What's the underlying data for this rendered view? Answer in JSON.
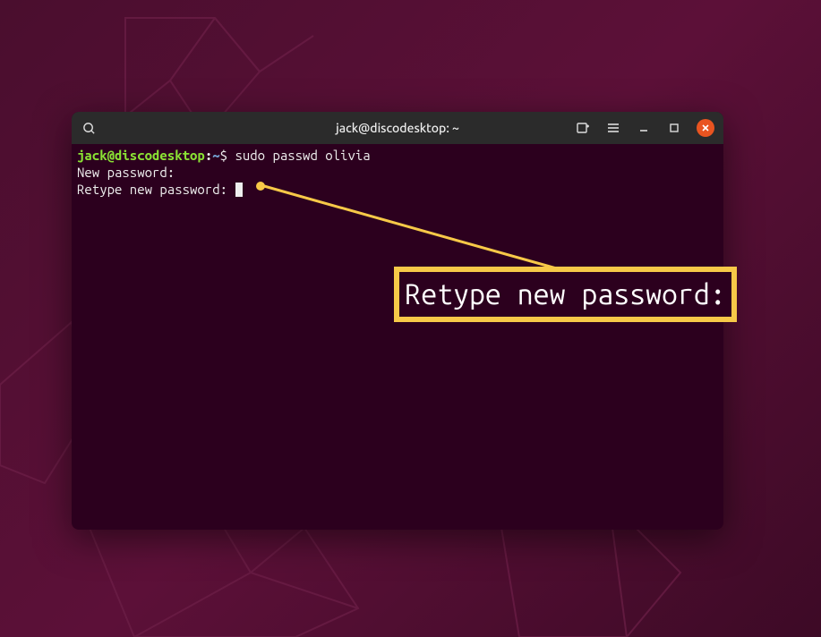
{
  "window": {
    "title": "jack@discodesktop: ~"
  },
  "terminal": {
    "prompt": {
      "user_host": "jack@discodesktop",
      "colon": ":",
      "path": "~",
      "symbol": "$"
    },
    "command": "sudo passwd olivia",
    "line2": "New password:",
    "line3": "Retype new password:"
  },
  "callout": {
    "text": "Retype new password:"
  },
  "icons": {
    "search": "search-icon",
    "new_tab": "new-tab-icon",
    "menu": "hamburger-menu-icon",
    "minimize": "minimize-icon",
    "maximize": "maximize-icon",
    "close": "close-icon"
  }
}
